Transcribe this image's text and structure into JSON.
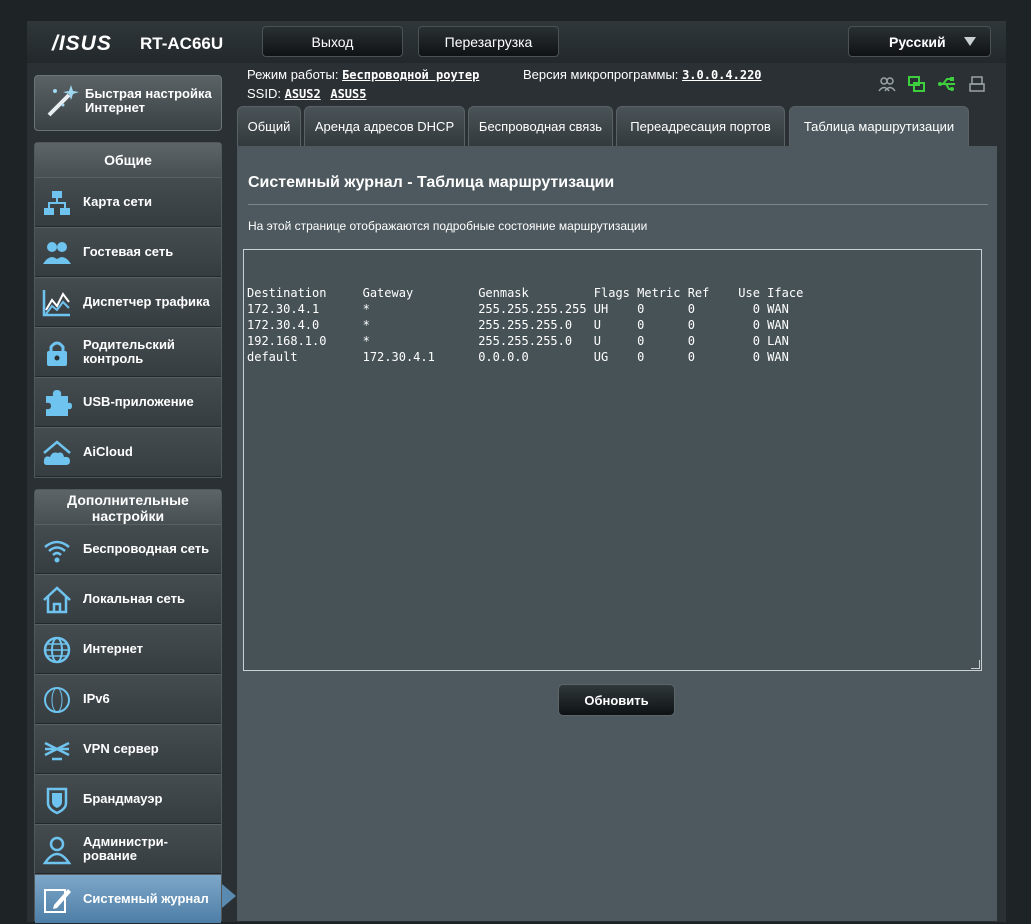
{
  "header": {
    "brand": "/ISUS",
    "model": "RT-AC66U",
    "logout_label": "Выход",
    "reboot_label": "Перезагрузка",
    "language": "Русский"
  },
  "info": {
    "mode_label": "Режим работы:",
    "mode_value": "Беспроводной роутер",
    "firmware_label": "Версия микропрограммы:",
    "firmware_value": "3.0.0.4.220",
    "ssid_label": "SSID:",
    "ssid_1": "ASUS2",
    "ssid_2": "ASUS5"
  },
  "status_icons": [
    "clients-icon",
    "network-icon",
    "usb-icon",
    "printer-icon"
  ],
  "status_colors": {
    "clients": "#9aa3a7",
    "network": "#3ecf3e",
    "usb": "#3ecf3e",
    "printer": "#9aa3a7"
  },
  "sidebar": {
    "quick_setup": "Быстрая настройка Интернет",
    "general_title": "Общие",
    "general_items": [
      {
        "label": "Карта сети",
        "icon": "network-map-icon"
      },
      {
        "label": "Гостевая сеть",
        "icon": "guest-network-icon"
      },
      {
        "label": "Диспетчер трафика",
        "icon": "traffic-manager-icon"
      },
      {
        "label": "Родительский контроль",
        "icon": "parental-lock-icon"
      },
      {
        "label": "USB-приложение",
        "icon": "puzzle-icon"
      },
      {
        "label": "AiCloud",
        "icon": "cloud-home-icon"
      }
    ],
    "advanced_title": "Дополнительные настройки",
    "advanced_items": [
      {
        "label": "Беспроводная сеть",
        "icon": "wifi-icon"
      },
      {
        "label": "Локальная сеть",
        "icon": "home-icon"
      },
      {
        "label": "Интернет",
        "icon": "globe-icon"
      },
      {
        "label": "IPv6",
        "icon": "ipv6-icon"
      },
      {
        "label": "VPN сервер",
        "icon": "vpn-icon"
      },
      {
        "label": "Брандмауэр",
        "icon": "shield-icon"
      },
      {
        "label": "Администри-рование",
        "icon": "admin-user-icon"
      },
      {
        "label": "Системный журнал",
        "icon": "log-edit-icon"
      }
    ]
  },
  "tabs": [
    {
      "label": "Общий"
    },
    {
      "label": "Аренда адресов DHCP"
    },
    {
      "label": "Беспроводная связь"
    },
    {
      "label": "Переадресация портов"
    },
    {
      "label": "Таблица маршрутизации"
    }
  ],
  "main": {
    "title": "Системный журнал - Таблица маршрутизации",
    "description": "На этой странице отображаются подробные состояние маршрутизации",
    "routing_table": "Destination     Gateway         Genmask         Flags Metric Ref    Use Iface\n172.30.4.1      *               255.255.255.255 UH    0      0        0 WAN\n172.30.4.0      *               255.255.255.0   U     0      0        0 WAN\n192.168.1.0     *               255.255.255.0   U     0      0        0 LAN\ndefault         172.30.4.1      0.0.0.0         UG    0      0        0 WAN",
    "refresh_label": "Обновить"
  }
}
